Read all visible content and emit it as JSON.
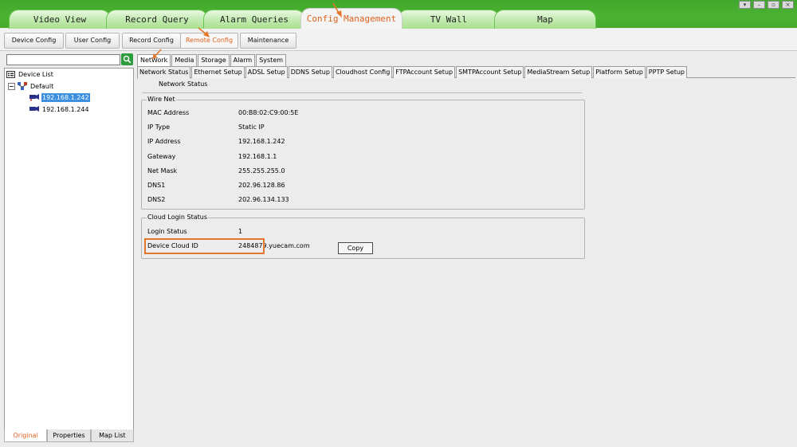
{
  "main_tabs": [
    {
      "label": "Video View"
    },
    {
      "label": "Record Query"
    },
    {
      "label": "Alarm Queries"
    },
    {
      "label": "Config Management",
      "active": true
    },
    {
      "label": "TV Wall"
    },
    {
      "label": "Map"
    }
  ],
  "sub_toolbar": [
    {
      "label": "Device Config"
    },
    {
      "label": "User Config"
    },
    {
      "label": "Record Config"
    },
    {
      "label": "Remote Config",
      "active": true
    },
    {
      "label": "Maintenance"
    }
  ],
  "search": {
    "value": "",
    "icon": "search-icon"
  },
  "tree": {
    "root": "Device List",
    "group": "Default",
    "devices": [
      {
        "label": "192.168.1.242",
        "selected": true
      },
      {
        "label": "192.168.1.244",
        "selected": false
      }
    ]
  },
  "left_tabs": [
    {
      "label": "Original",
      "active": true
    },
    {
      "label": "Properties"
    },
    {
      "label": "Map List"
    }
  ],
  "top_tabs": [
    {
      "label": "NetWork",
      "active": true
    },
    {
      "label": "Media"
    },
    {
      "label": "Storage"
    },
    {
      "label": "Alarm"
    },
    {
      "label": "System"
    }
  ],
  "sub_tabs": [
    {
      "label": "Network Status",
      "active": true
    },
    {
      "label": "Ethernet Setup"
    },
    {
      "label": "ADSL Setup"
    },
    {
      "label": "DDNS Setup"
    },
    {
      "label": "Cloudhost Config"
    },
    {
      "label": "FTPAccount Setup"
    },
    {
      "label": "SMTPAccount Setup"
    },
    {
      "label": "MediaStream Setup"
    },
    {
      "label": "Platform Setup"
    },
    {
      "label": "PPTP Setup"
    }
  ],
  "network_status": {
    "title": "Network Status",
    "wire_net": {
      "legend": "Wire Net",
      "rows": [
        {
          "label": "MAC Address",
          "value": "00:B8:02:C9:00:5E"
        },
        {
          "label": "IP Type",
          "value": "Static IP"
        },
        {
          "label": "IP Address",
          "value": "192.168.1.242"
        },
        {
          "label": "Gateway",
          "value": "192.168.1.1"
        },
        {
          "label": "Net Mask",
          "value": "255.255.255.0"
        },
        {
          "label": "DNS1",
          "value": "202.96.128.86"
        },
        {
          "label": "DNS2",
          "value": "202.96.134.133"
        }
      ]
    },
    "cloud": {
      "legend": "Cloud Login Status",
      "login_status_label": "Login Status",
      "login_status_value": "1",
      "cloud_id_label": "Device Cloud ID",
      "cloud_id_value": "2484879.yuecam.com",
      "copy_label": "Copy"
    }
  },
  "colors": {
    "accent_orange": "#e0621e",
    "highlight_orange": "#e3772b",
    "titlebar_green": "#46ab2e",
    "selection_blue": "#3b8ee0"
  }
}
